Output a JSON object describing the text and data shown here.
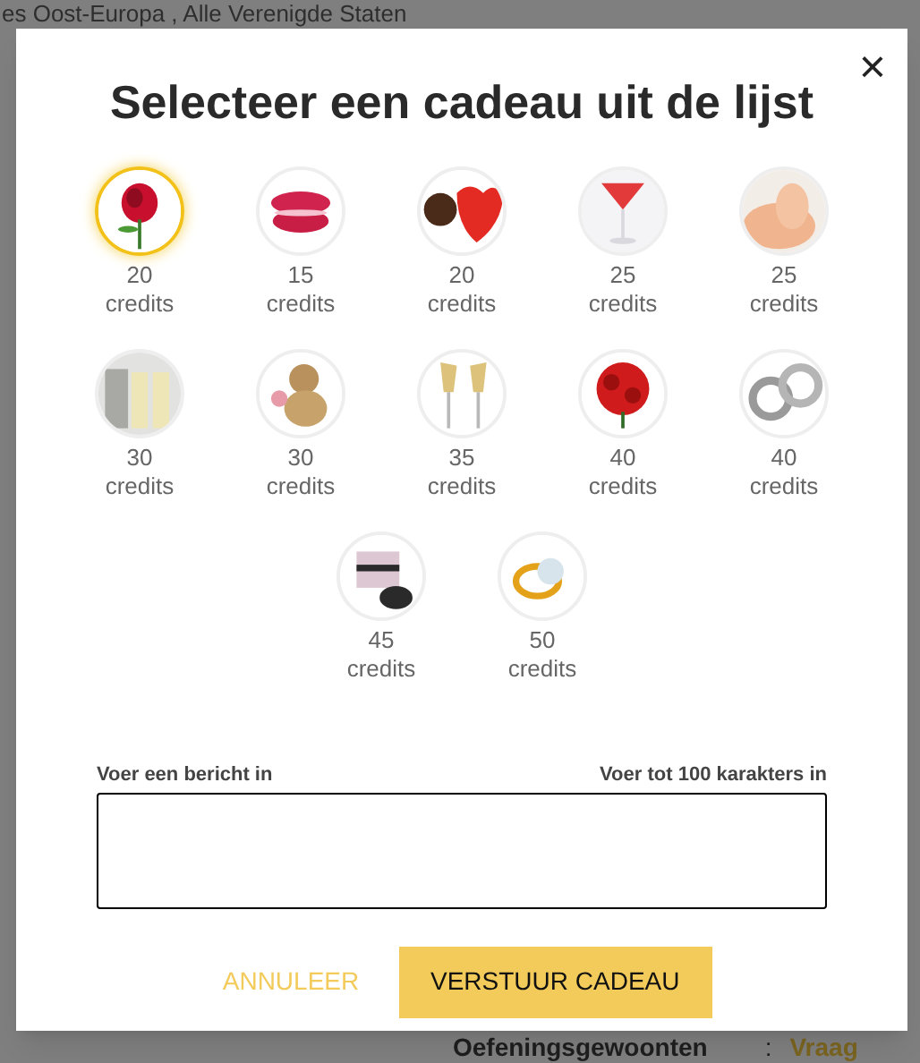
{
  "background_page": {
    "header_text": "es Oost-Europa , Alle Verenigde Staten",
    "footer_label": "Oefeningsgewoonten",
    "footer_separator": ":",
    "footer_value": "Vraag"
  },
  "dialog": {
    "title": "Selecteer een cadeau uit de lijst",
    "close": "×",
    "gifts": [
      {
        "kind": "picture",
        "amount": "20",
        "unit": "credits",
        "selected": true
      },
      {
        "kind": "picture",
        "amount": "15",
        "unit": "credits",
        "selected": false
      },
      {
        "kind": "picture",
        "amount": "20",
        "unit": "credits",
        "selected": false
      },
      {
        "kind": "picture",
        "amount": "25",
        "unit": "credits",
        "selected": false
      },
      {
        "kind": "picture",
        "amount": "25",
        "unit": "credits",
        "selected": false
      },
      {
        "kind": "picture",
        "amount": "30",
        "unit": "credits",
        "selected": false
      },
      {
        "kind": "picture",
        "amount": "30",
        "unit": "credits",
        "selected": false
      },
      {
        "kind": "picture",
        "amount": "35",
        "unit": "credits",
        "selected": false
      },
      {
        "kind": "picture",
        "amount": "40",
        "unit": "credits",
        "selected": false
      },
      {
        "kind": "picture",
        "amount": "40",
        "unit": "credits",
        "selected": false
      },
      {
        "kind": "picture",
        "amount": "45",
        "unit": "credits",
        "selected": false
      },
      {
        "kind": "picture",
        "amount": "50",
        "unit": "credits",
        "selected": false
      }
    ],
    "message_label": "Voer een bericht in",
    "limit_label": "Voer tot 100 karakters in",
    "cancel_button": "ANNULEER",
    "send_button": "VERSTUUR CADEAU"
  }
}
